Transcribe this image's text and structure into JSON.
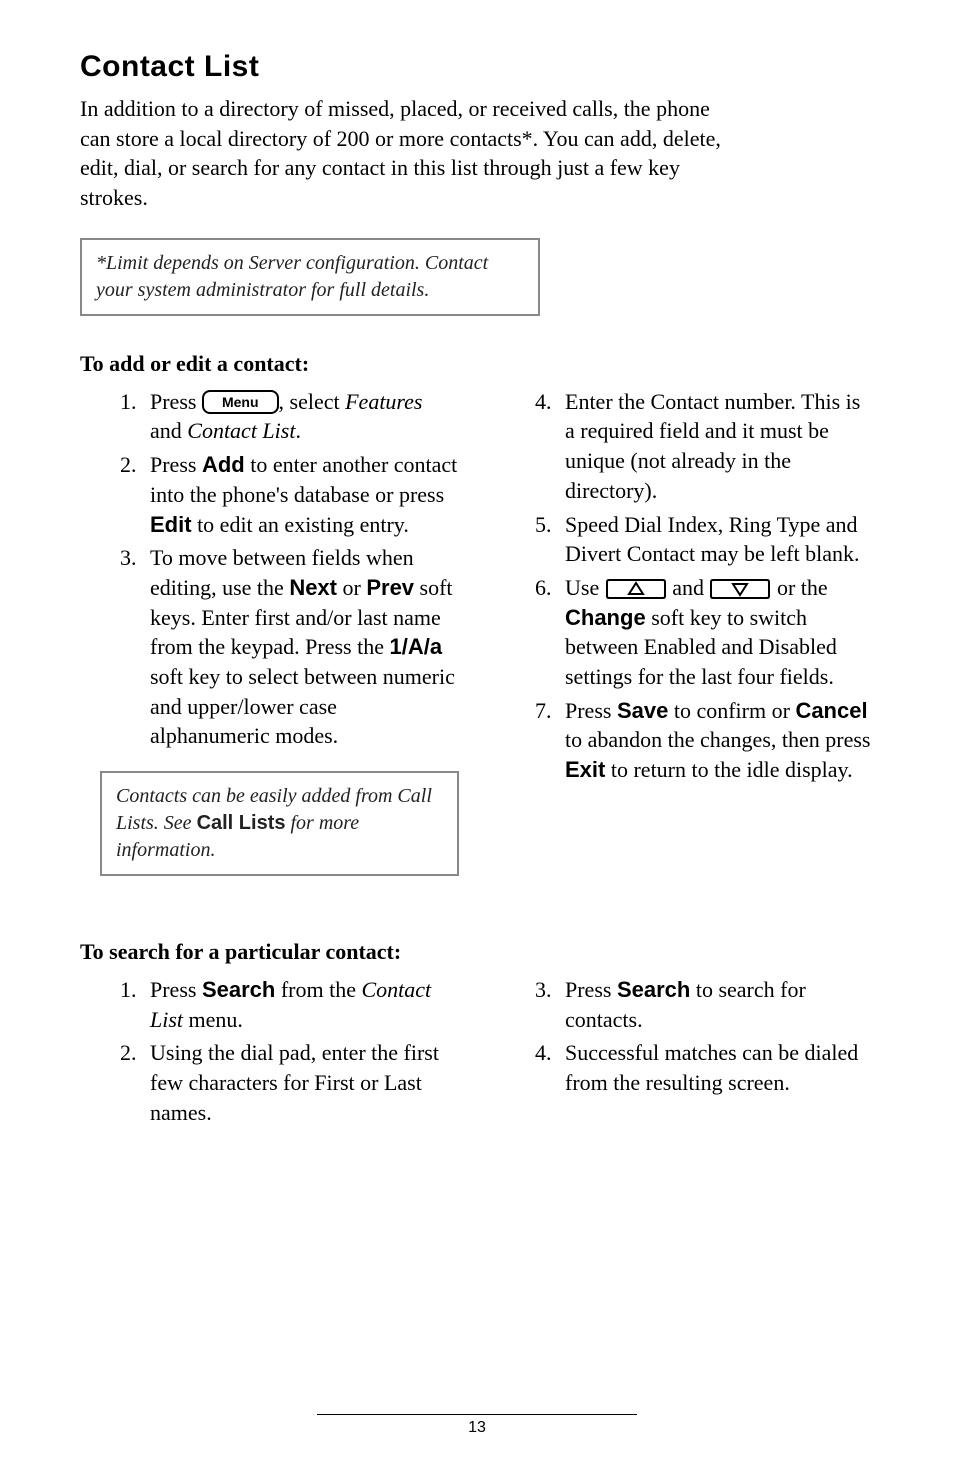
{
  "title": "Contact List",
  "intro": "In addition to a directory of missed, placed, or received calls, the phone can store a local directory of 200 or more contacts*.  You can add, delete, edit, dial, or search for any contact in this list through just a few key strokes.",
  "note1_a": "*Limit depends on Server configuration.  Contact your system administrator for full details.",
  "subhead1": "To add or edit a contact:",
  "menu_label": "Menu",
  "left": {
    "n1": "1.",
    "li1_a": "Press ",
    "li1_b": ", select ",
    "li1_features": "Features",
    "li1_c": " and ",
    "li1_cl": "Contact List",
    "li1_d": ".",
    "n2": "2.",
    "li2_a": "Press ",
    "li2_add": "Add",
    "li2_b": " to enter another contact into the phone's database or press ",
    "li2_edit": "Edit",
    "li2_c": " to edit an existing entry.",
    "n3": "3.",
    "li3_a": "To move between fields when editing, use the ",
    "li3_next": "Next",
    "li3_b": " or ",
    "li3_prev": "Prev",
    "li3_c": " soft keys.  Enter first and/or last name from the keypad.  Press the ",
    "li3_1aa": "1/A/a",
    "li3_d": " soft key to select between numeric and upper/lower case alphanumeric modes."
  },
  "right": {
    "n4": "4.",
    "li4": "Enter the Contact number.  This is a required field and it must be unique (not already in the directory).",
    "n5": "5.",
    "li5": "Speed Dial Index, Ring Type and Divert Contact may be left blank.",
    "n6": "6.",
    "li6_a": "Use ",
    "li6_b": " and ",
    "li6_c": " or the ",
    "li6_change": "Change",
    "li6_d": " soft key to switch between Enabled and Disabled settings for the last four fields.",
    "n7": "7.",
    "li7_a": "Press ",
    "li7_save": "Save",
    "li7_b": " to confirm or ",
    "li7_cancel": "Cancel",
    "li7_c": " to abandon the changes, then press ",
    "li7_exit": "Exit",
    "li7_d": " to return to the idle display."
  },
  "note2_a": "Contacts can be easily added from Call Lists.  See ",
  "note2_bold": "Call Lists",
  "note2_c": " for more information.",
  "subhead2": "To search for a particular contact:",
  "bl": {
    "n1": "1.",
    "li1_a": "Press ",
    "li1_search": "Search",
    "li1_b": " from the ",
    "li1_cl": "Contact List",
    "li1_c": " menu.",
    "n2": "2.",
    "li2": "Using the dial pad, enter the first few characters for First or Last names."
  },
  "br": {
    "n3": "3.",
    "li3_a": "Press ",
    "li3_search": "Search",
    "li3_b": " to search for contacts.",
    "n4": "4.",
    "li4": "Successful matches can be dialed from the resulting screen."
  },
  "page_num": "13"
}
